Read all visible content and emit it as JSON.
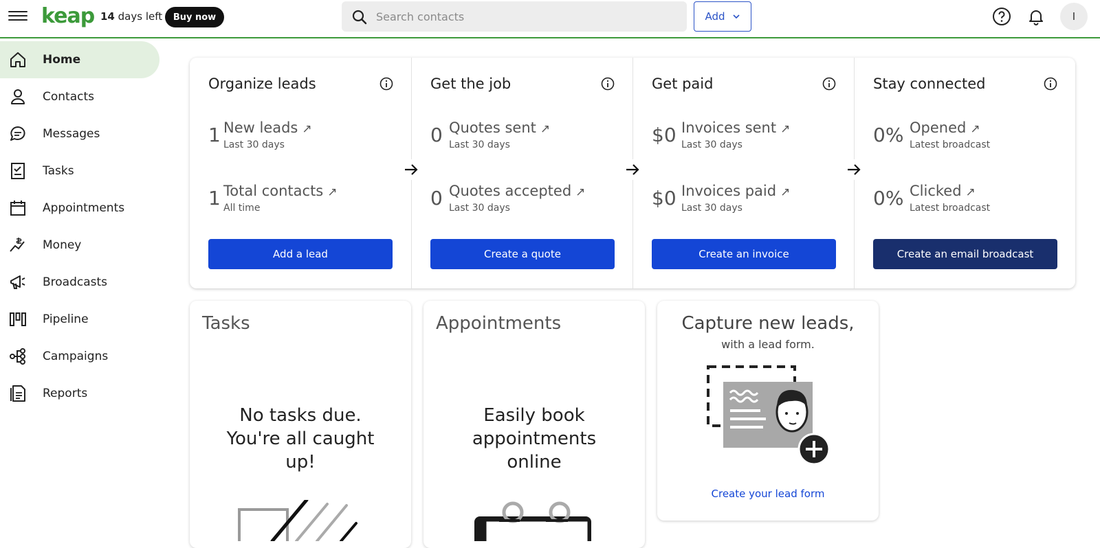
{
  "header": {
    "logo": "keap",
    "trial_days": "14",
    "trial_suffix": "days left",
    "buy_label": "Buy now",
    "search_placeholder": "Search contacts",
    "add_label": "Add",
    "avatar_initial": "I"
  },
  "sidebar": {
    "items": [
      {
        "label": "Home",
        "icon": "home-icon",
        "active": true
      },
      {
        "label": "Contacts",
        "icon": "person-icon"
      },
      {
        "label": "Messages",
        "icon": "chat-icon"
      },
      {
        "label": "Tasks",
        "icon": "checklist-icon"
      },
      {
        "label": "Appointments",
        "icon": "calendar-icon"
      },
      {
        "label": "Money",
        "icon": "money-icon"
      },
      {
        "label": "Broadcasts",
        "icon": "megaphone-icon"
      },
      {
        "label": "Pipeline",
        "icon": "pipeline-icon"
      },
      {
        "label": "Campaigns",
        "icon": "campaigns-icon"
      },
      {
        "label": "Reports",
        "icon": "report-icon"
      }
    ]
  },
  "overview": {
    "columns": [
      {
        "title": "Organize leads",
        "metrics": [
          {
            "value": "1",
            "label": "New leads",
            "sub": "Last 30 days"
          },
          {
            "value": "1",
            "label": "Total contacts",
            "sub": "All time"
          }
        ],
        "button": "Add a lead"
      },
      {
        "title": "Get the job",
        "metrics": [
          {
            "value": "0",
            "label": "Quotes sent",
            "sub": "Last 30 days"
          },
          {
            "value": "0",
            "label": "Quotes accepted",
            "sub": "Last 30 days"
          }
        ],
        "button": "Create a quote"
      },
      {
        "title": "Get paid",
        "metrics": [
          {
            "value": "$0",
            "label": "Invoices sent",
            "sub": "Last 30 days"
          },
          {
            "value": "$0",
            "label": "Invoices paid",
            "sub": "Last 30 days"
          }
        ],
        "button": "Create an invoice"
      },
      {
        "title": "Stay connected",
        "metrics": [
          {
            "value": "0%",
            "label": "Opened",
            "sub": "Latest broadcast"
          },
          {
            "value": "0%",
            "label": "Clicked",
            "sub": "Latest broadcast"
          }
        ],
        "button": "Create an email broadcast"
      }
    ]
  },
  "cards": {
    "tasks": {
      "title": "Tasks",
      "message": "No tasks due. You're all caught up!"
    },
    "appointments": {
      "title": "Appointments",
      "message": "Easily book appointments online"
    },
    "leads": {
      "title": "Capture new leads,",
      "subtitle": "with a lead form.",
      "link": "Create your lead form"
    }
  },
  "colors": {
    "brand_green": "#3c9a3a",
    "primary_blue": "#1446d6",
    "dark_navy": "#192f6d",
    "active_nav_bg": "#e3f0e0"
  }
}
